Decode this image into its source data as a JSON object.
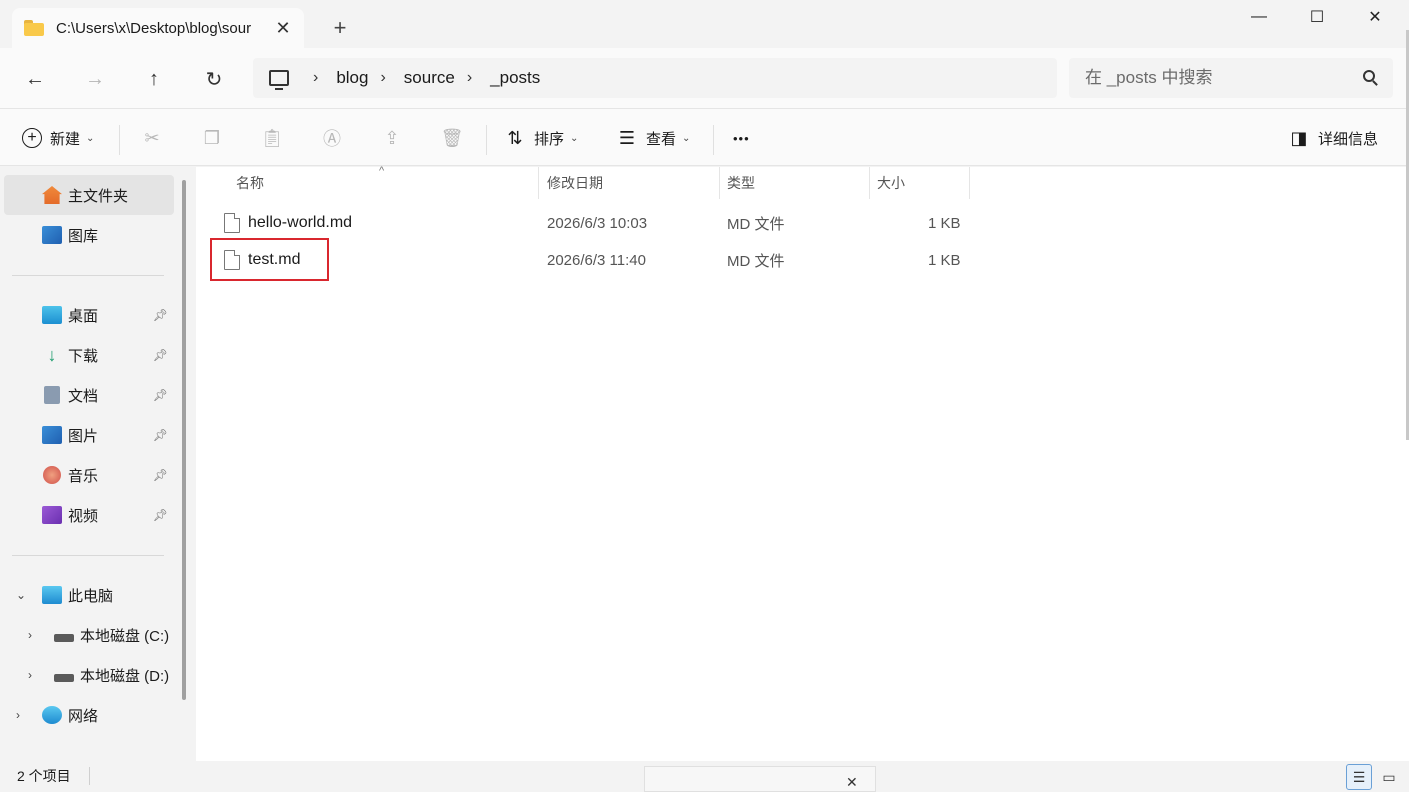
{
  "window": {
    "tab_title": "C:\\Users\\x\\Desktop\\blog\\sour",
    "tab_close": "✕",
    "new_tab": "+",
    "minimize": "—",
    "maximize": "☐",
    "close": "✕"
  },
  "address_bar": {
    "back": "←",
    "forward": "→",
    "up": "↑",
    "refresh": "↻",
    "separator": "›",
    "breadcrumbs": [
      "blog",
      "source",
      "_posts"
    ],
    "search_placeholder": "在 _posts 中搜索"
  },
  "command_bar": {
    "new_label": "新建",
    "sort_label": "排序",
    "view_label": "查看",
    "more_label": "•••",
    "details_label": "详细信息",
    "chevron": "⌄"
  },
  "sidebar": {
    "home": "主文件夹",
    "gallery": "图库",
    "quick_access": [
      {
        "label": "桌面"
      },
      {
        "label": "下载"
      },
      {
        "label": "文档"
      },
      {
        "label": "图片"
      },
      {
        "label": "音乐"
      },
      {
        "label": "视频"
      }
    ],
    "this_pc": "此电脑",
    "drives": [
      "本地磁盘 (C:)",
      "本地磁盘 (D:)"
    ],
    "network": "网络"
  },
  "file_list": {
    "columns": [
      "名称",
      "修改日期",
      "类型",
      "大小"
    ],
    "sort_indicator": "^",
    "files": [
      {
        "name": "hello-world.md",
        "modified": "2026/6/3 10:03",
        "type": "MD 文件",
        "size": "1 KB"
      },
      {
        "name": "test.md",
        "modified": "2026/6/3 11:40",
        "type": "MD 文件",
        "size": "1 KB"
      }
    ],
    "highlight_color": "#d9272e"
  },
  "status_bar": {
    "item_count": "2 个项目"
  }
}
